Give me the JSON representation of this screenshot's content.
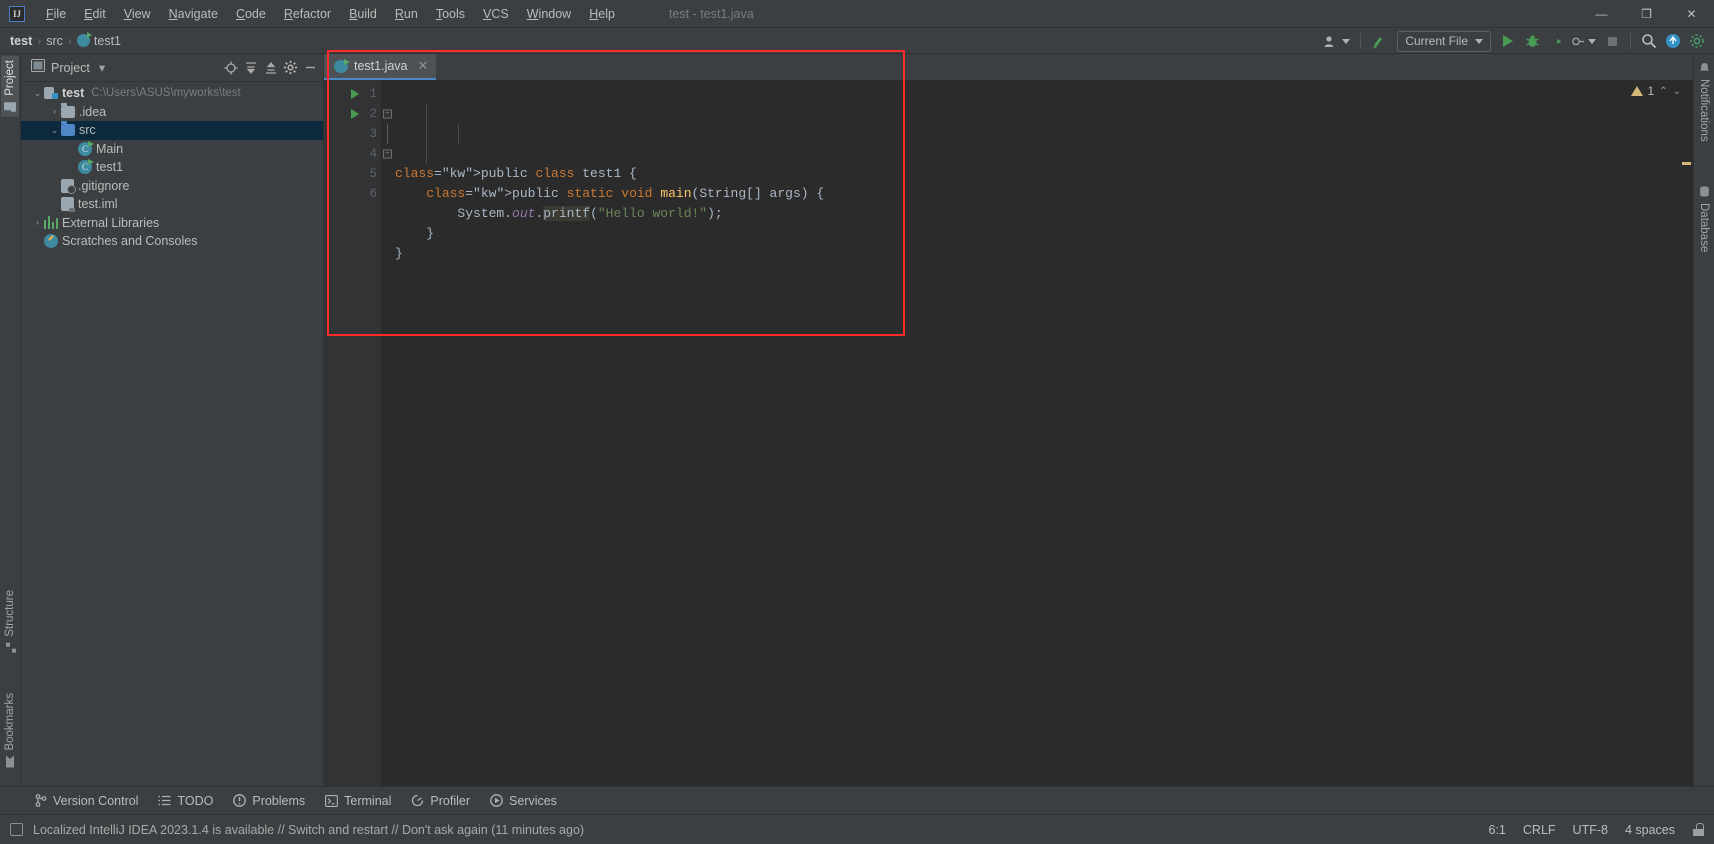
{
  "window": {
    "title": "test - test1.java",
    "logo_text": "IJ",
    "controls": {
      "minimize": "—",
      "maximize": "❐",
      "close": "✕"
    }
  },
  "menu": {
    "items": [
      "File",
      "Edit",
      "View",
      "Navigate",
      "Code",
      "Refactor",
      "Build",
      "Run",
      "Tools",
      "VCS",
      "Window",
      "Help"
    ]
  },
  "breadcrumb": {
    "separator": "›",
    "items": [
      {
        "label": "test",
        "bold": true,
        "icon": "none"
      },
      {
        "label": "src",
        "bold": false,
        "icon": "none"
      },
      {
        "label": "test1",
        "bold": false,
        "icon": "java-class-icon"
      }
    ]
  },
  "toolbar": {
    "account_icon": "user-icon",
    "updates_icon": "update-arrow-icon",
    "run_config_label": "Current File",
    "run_icon": "run-icon",
    "debug_icon": "debug-icon",
    "run_coverage_icon": "run-with-coverage-icon",
    "more_run_icon": "more-run-options-icon",
    "stop_icon": "stop-icon",
    "search_icon": "search-everywhere-icon",
    "update_project_icon": "update-project-icon",
    "settings_icon": "settings-icon"
  },
  "left_strip": {
    "items": [
      {
        "label": "Project",
        "icon": "project-folder-icon",
        "active": true
      },
      {
        "label": "Structure",
        "icon": "structure-icon",
        "active": false
      },
      {
        "label": "Bookmarks",
        "icon": "bookmarks-icon",
        "active": false
      }
    ]
  },
  "right_strip": {
    "items": [
      {
        "label": "Notifications",
        "icon": "notifications-icon"
      },
      {
        "label": "Database",
        "icon": "database-icon"
      }
    ]
  },
  "project_panel": {
    "title": "Project",
    "dropdown_caret": "▾",
    "actions": [
      {
        "name": "select-opened-file",
        "glyph": "⊕"
      },
      {
        "name": "expand-all",
        "glyph": "≣"
      },
      {
        "name": "collapse-all",
        "glyph": "≡"
      },
      {
        "name": "settings",
        "glyph": "⚙"
      },
      {
        "name": "hide",
        "glyph": "—"
      }
    ],
    "tree": [
      {
        "label": "test",
        "path": "C:\\Users\\ASUS\\myworks\\test",
        "icon": "module-icon",
        "arrow": "⌄",
        "indent": 0,
        "bold": true,
        "selected": false
      },
      {
        "label": ".idea",
        "path": "",
        "icon": "folder-icon",
        "arrow": "›",
        "indent": 1,
        "bold": false,
        "selected": false
      },
      {
        "label": "src",
        "path": "",
        "icon": "source-folder-icon",
        "arrow": "⌄",
        "indent": 1,
        "bold": false,
        "selected": true
      },
      {
        "label": "Main",
        "path": "",
        "icon": "java-class-icon",
        "arrow": "",
        "indent": 2,
        "bold": false,
        "selected": false
      },
      {
        "label": "test1",
        "path": "",
        "icon": "java-class-icon",
        "arrow": "",
        "indent": 2,
        "bold": false,
        "selected": false
      },
      {
        "label": ".gitignore",
        "path": "",
        "icon": "gitignore-file-icon",
        "arrow": "",
        "indent": 1,
        "bold": false,
        "selected": false
      },
      {
        "label": "test.iml",
        "path": "",
        "icon": "iml-file-icon",
        "arrow": "",
        "indent": 1,
        "bold": false,
        "selected": false
      },
      {
        "label": "External Libraries",
        "path": "",
        "icon": "libraries-icon",
        "arrow": "›",
        "indent": 0,
        "bold": false,
        "selected": false
      },
      {
        "label": "Scratches and Consoles",
        "path": "",
        "icon": "scratches-icon",
        "arrow": "",
        "indent": 0,
        "bold": false,
        "selected": false
      }
    ]
  },
  "editor": {
    "tab": {
      "label": "test1.java",
      "icon": "java-class-icon",
      "close_glyph": "✕"
    },
    "inspection": {
      "count": "1",
      "warn_icon": "warning-triangle-icon",
      "up_glyph": "⌃",
      "down_glyph": "⌄"
    },
    "lines": [
      {
        "num": "1",
        "run_marker": true,
        "fold": "none"
      },
      {
        "num": "2",
        "run_marker": true,
        "fold": "open"
      },
      {
        "num": "3",
        "run_marker": false,
        "fold": "bar"
      },
      {
        "num": "4",
        "run_marker": false,
        "fold": "close"
      },
      {
        "num": "5",
        "run_marker": false,
        "fold": "none"
      },
      {
        "num": "6",
        "run_marker": false,
        "fold": "none"
      }
    ],
    "code_text": [
      "public class test1 {",
      "    public static void main(String[] args) {",
      "        System.out.printf(\"Hello world!\");",
      "    }",
      "}",
      ""
    ]
  },
  "bottom_tools": {
    "items": [
      {
        "label": "Version Control",
        "icon": "branch-icon"
      },
      {
        "label": "TODO",
        "icon": "todo-list-icon"
      },
      {
        "label": "Problems",
        "icon": "problems-icon"
      },
      {
        "label": "Terminal",
        "icon": "terminal-icon"
      },
      {
        "label": "Profiler",
        "icon": "profiler-icon"
      },
      {
        "label": "Services",
        "icon": "services-icon"
      }
    ]
  },
  "status_bar": {
    "message_icon": "notification-icon",
    "message": "Localized IntelliJ IDEA 2023.1.4 is available // Switch and restart // Don't ask again (11 minutes ago)",
    "caret_position": "6:1",
    "line_separator": "CRLF",
    "encoding": "UTF-8",
    "indent": "4 spaces",
    "lock_icon": "read-only-toggle-icon"
  },
  "colors": {
    "bg_panel": "#3c3f41",
    "bg_editor": "#2b2b2b",
    "gutter": "#313335",
    "selection": "#0d293e",
    "accent_blue": "#4a88c7",
    "keyword_orange": "#cc7832",
    "string_green": "#6a8759",
    "method_yellow": "#ffc66d",
    "field_purple": "#9876aa",
    "annotation_red": "#ff2a2a",
    "run_green": "#499c54",
    "warning_yellow": "#d5b778"
  }
}
